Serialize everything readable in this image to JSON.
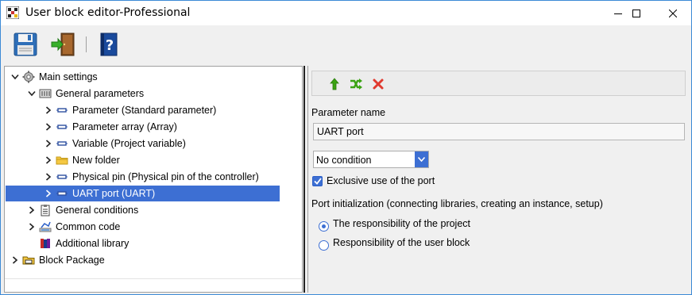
{
  "window": {
    "title": "User block editor-Professional",
    "controls": {
      "minimize_icon": "minimize-icon",
      "maximize_icon": "maximize-icon",
      "close_icon": "close-icon"
    }
  },
  "toolbar": {
    "buttons": [
      {
        "name": "save-button",
        "icon": "floppy-disk-icon"
      },
      {
        "name": "exit-button",
        "icon": "door-exit-icon"
      },
      {
        "name": "help-button",
        "icon": "help-book-icon"
      }
    ]
  },
  "tree": {
    "items": [
      {
        "label": "Main settings",
        "level": 0,
        "expanded": true,
        "icon": "gear-icon"
      },
      {
        "label": "General parameters",
        "level": 1,
        "expanded": true,
        "icon": "parameters-icon"
      },
      {
        "label": "Parameter (Standard parameter)",
        "level": 2,
        "expanded": false,
        "icon": "param-item-icon"
      },
      {
        "label": "Parameter array (Array)",
        "level": 2,
        "expanded": false,
        "icon": "param-item-icon"
      },
      {
        "label": "Variable (Project variable)",
        "level": 2,
        "expanded": false,
        "icon": "param-item-icon"
      },
      {
        "label": "New folder",
        "level": 2,
        "expanded": false,
        "icon": "folder-icon"
      },
      {
        "label": "Physical pin (Physical pin of the controller)",
        "level": 2,
        "expanded": false,
        "icon": "param-item-icon"
      },
      {
        "label": "UART port (UART)",
        "level": 2,
        "expanded": false,
        "icon": "param-item-icon",
        "selected": true
      },
      {
        "label": "General conditions",
        "level": 1,
        "expanded": false,
        "icon": "clipboard-icon"
      },
      {
        "label": "Common code",
        "level": 1,
        "expanded": false,
        "icon": "code-icon"
      },
      {
        "label": "Additional library",
        "level": 1,
        "expanded": null,
        "icon": "library-books-icon"
      },
      {
        "label": "Block Package",
        "level": 0,
        "expanded": false,
        "icon": "package-icon"
      }
    ]
  },
  "editor": {
    "sub_toolbar": [
      {
        "name": "move-up-button",
        "icon": "arrow-up-icon",
        "color": "#3aa312"
      },
      {
        "name": "shuffle-button",
        "icon": "shuffle-icon",
        "color": "#3aa312"
      },
      {
        "name": "delete-button",
        "icon": "red-x-icon",
        "color": "#e03a2f"
      }
    ],
    "parameter_name_label": "Parameter name",
    "parameter_name_value": "UART port",
    "condition_select_value": "No condition",
    "exclusive_checkbox_label": "Exclusive use of the port",
    "exclusive_checked": true,
    "port_init_label": "Port initialization (connecting libraries, creating an instance, setup)",
    "radio_options": [
      {
        "label": "The responsibility of the project",
        "selected": true
      },
      {
        "label": "Responsibility of the user block",
        "selected": false
      }
    ]
  },
  "colors": {
    "accent": "#3d6fd3",
    "window_border": "#3c8ad6"
  }
}
